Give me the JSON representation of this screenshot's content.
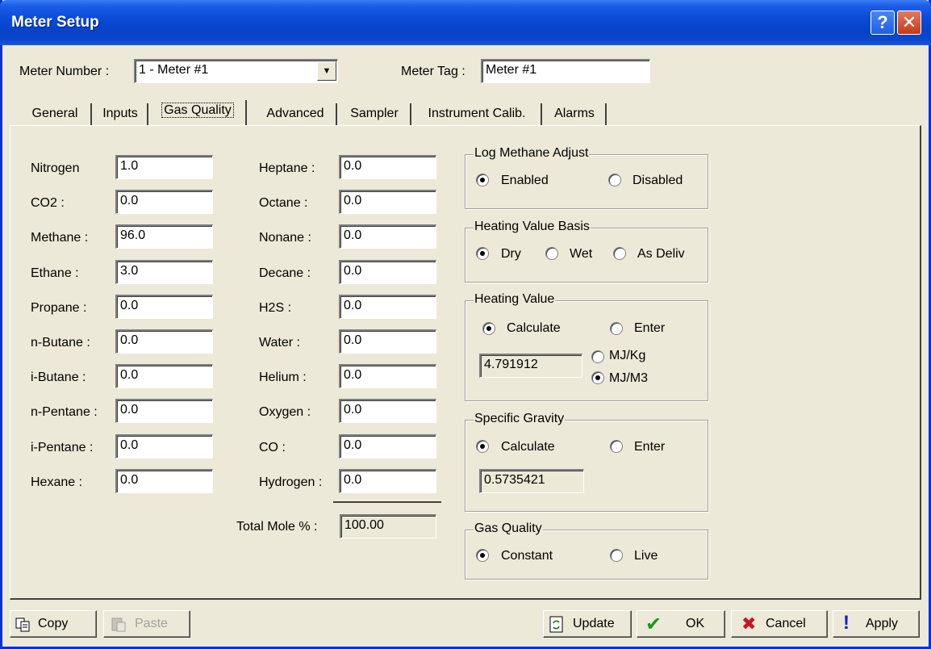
{
  "window": {
    "title": "Meter Setup",
    "help_label": "?",
    "close_label": "✕"
  },
  "header": {
    "meter_number_label": "Meter Number :",
    "meter_number_value": "1 - Meter #1",
    "meter_tag_label": "Meter Tag :",
    "meter_tag_value": "Meter #1"
  },
  "tabs": [
    "General",
    "Inputs",
    "Gas Quality",
    "Advanced",
    "Sampler",
    "Instrument Calib.",
    "Alarms"
  ],
  "active_tab": "Gas Quality",
  "components_left": [
    {
      "label": "Nitrogen",
      "value": "1.0"
    },
    {
      "label": "CO2 :",
      "value": "0.0"
    },
    {
      "label": "Methane :",
      "value": "96.0"
    },
    {
      "label": "Ethane :",
      "value": "3.0"
    },
    {
      "label": "Propane :",
      "value": "0.0"
    },
    {
      "label": "n-Butane :",
      "value": "0.0"
    },
    {
      "label": "i-Butane :",
      "value": "0.0"
    },
    {
      "label": "n-Pentane :",
      "value": "0.0"
    },
    {
      "label": "i-Pentane :",
      "value": "0.0"
    },
    {
      "label": "Hexane :",
      "value": "0.0"
    }
  ],
  "components_right": [
    {
      "label": "Heptane :",
      "value": "0.0"
    },
    {
      "label": "Octane :",
      "value": "0.0"
    },
    {
      "label": "Nonane :",
      "value": "0.0"
    },
    {
      "label": "Decane :",
      "value": "0.0"
    },
    {
      "label": "H2S :",
      "value": "0.0"
    },
    {
      "label": "Water :",
      "value": "0.0"
    },
    {
      "label": "Helium :",
      "value": "0.0"
    },
    {
      "label": "Oxygen :",
      "value": "0.0"
    },
    {
      "label": "CO :",
      "value": "0.0"
    },
    {
      "label": "Hydrogen :",
      "value": "0.0"
    }
  ],
  "total": {
    "label": "Total Mole % :",
    "value": "100.00"
  },
  "log_methane": {
    "title": "Log Methane Adjust",
    "options": [
      "Enabled",
      "Disabled"
    ],
    "selected": "Enabled"
  },
  "heating_basis": {
    "title": "Heating Value Basis",
    "options": [
      "Dry",
      "Wet",
      "As Deliv"
    ],
    "selected": "Dry"
  },
  "heating_value": {
    "title": "Heating Value",
    "options": [
      "Calculate",
      "Enter"
    ],
    "selected": "Calculate",
    "value": "4.791912",
    "unit_options": [
      "MJ/Kg",
      "MJ/M3"
    ],
    "unit_selected": "MJ/M3"
  },
  "specific_gravity": {
    "title": "Specific Gravity",
    "options": [
      "Calculate",
      "Enter"
    ],
    "selected": "Calculate",
    "value": "0.5735421"
  },
  "gas_quality": {
    "title": "Gas Quality",
    "options": [
      "Constant",
      "Live"
    ],
    "selected": "Constant"
  },
  "buttons": {
    "copy": "Copy",
    "paste": "Paste",
    "update": "Update",
    "ok": "OK",
    "cancel": "Cancel",
    "apply": "Apply"
  }
}
